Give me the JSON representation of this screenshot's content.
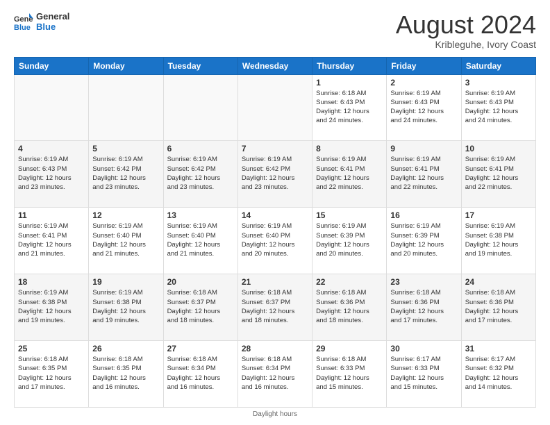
{
  "logo": {
    "line1": "General",
    "line2": "Blue"
  },
  "title": "August 2024",
  "subtitle": "Kribleguhe, Ivory Coast",
  "weekdays": [
    "Sunday",
    "Monday",
    "Tuesday",
    "Wednesday",
    "Thursday",
    "Friday",
    "Saturday"
  ],
  "footer": "Daylight hours",
  "weeks": [
    [
      {
        "day": "",
        "info": ""
      },
      {
        "day": "",
        "info": ""
      },
      {
        "day": "",
        "info": ""
      },
      {
        "day": "",
        "info": ""
      },
      {
        "day": "1",
        "info": "Sunrise: 6:18 AM\nSunset: 6:43 PM\nDaylight: 12 hours\nand 24 minutes."
      },
      {
        "day": "2",
        "info": "Sunrise: 6:19 AM\nSunset: 6:43 PM\nDaylight: 12 hours\nand 24 minutes."
      },
      {
        "day": "3",
        "info": "Sunrise: 6:19 AM\nSunset: 6:43 PM\nDaylight: 12 hours\nand 24 minutes."
      }
    ],
    [
      {
        "day": "4",
        "info": "Sunrise: 6:19 AM\nSunset: 6:43 PM\nDaylight: 12 hours\nand 23 minutes."
      },
      {
        "day": "5",
        "info": "Sunrise: 6:19 AM\nSunset: 6:42 PM\nDaylight: 12 hours\nand 23 minutes."
      },
      {
        "day": "6",
        "info": "Sunrise: 6:19 AM\nSunset: 6:42 PM\nDaylight: 12 hours\nand 23 minutes."
      },
      {
        "day": "7",
        "info": "Sunrise: 6:19 AM\nSunset: 6:42 PM\nDaylight: 12 hours\nand 23 minutes."
      },
      {
        "day": "8",
        "info": "Sunrise: 6:19 AM\nSunset: 6:41 PM\nDaylight: 12 hours\nand 22 minutes."
      },
      {
        "day": "9",
        "info": "Sunrise: 6:19 AM\nSunset: 6:41 PM\nDaylight: 12 hours\nand 22 minutes."
      },
      {
        "day": "10",
        "info": "Sunrise: 6:19 AM\nSunset: 6:41 PM\nDaylight: 12 hours\nand 22 minutes."
      }
    ],
    [
      {
        "day": "11",
        "info": "Sunrise: 6:19 AM\nSunset: 6:41 PM\nDaylight: 12 hours\nand 21 minutes."
      },
      {
        "day": "12",
        "info": "Sunrise: 6:19 AM\nSunset: 6:40 PM\nDaylight: 12 hours\nand 21 minutes."
      },
      {
        "day": "13",
        "info": "Sunrise: 6:19 AM\nSunset: 6:40 PM\nDaylight: 12 hours\nand 21 minutes."
      },
      {
        "day": "14",
        "info": "Sunrise: 6:19 AM\nSunset: 6:40 PM\nDaylight: 12 hours\nand 20 minutes."
      },
      {
        "day": "15",
        "info": "Sunrise: 6:19 AM\nSunset: 6:39 PM\nDaylight: 12 hours\nand 20 minutes."
      },
      {
        "day": "16",
        "info": "Sunrise: 6:19 AM\nSunset: 6:39 PM\nDaylight: 12 hours\nand 20 minutes."
      },
      {
        "day": "17",
        "info": "Sunrise: 6:19 AM\nSunset: 6:38 PM\nDaylight: 12 hours\nand 19 minutes."
      }
    ],
    [
      {
        "day": "18",
        "info": "Sunrise: 6:19 AM\nSunset: 6:38 PM\nDaylight: 12 hours\nand 19 minutes."
      },
      {
        "day": "19",
        "info": "Sunrise: 6:19 AM\nSunset: 6:38 PM\nDaylight: 12 hours\nand 19 minutes."
      },
      {
        "day": "20",
        "info": "Sunrise: 6:18 AM\nSunset: 6:37 PM\nDaylight: 12 hours\nand 18 minutes."
      },
      {
        "day": "21",
        "info": "Sunrise: 6:18 AM\nSunset: 6:37 PM\nDaylight: 12 hours\nand 18 minutes."
      },
      {
        "day": "22",
        "info": "Sunrise: 6:18 AM\nSunset: 6:36 PM\nDaylight: 12 hours\nand 18 minutes."
      },
      {
        "day": "23",
        "info": "Sunrise: 6:18 AM\nSunset: 6:36 PM\nDaylight: 12 hours\nand 17 minutes."
      },
      {
        "day": "24",
        "info": "Sunrise: 6:18 AM\nSunset: 6:36 PM\nDaylight: 12 hours\nand 17 minutes."
      }
    ],
    [
      {
        "day": "25",
        "info": "Sunrise: 6:18 AM\nSunset: 6:35 PM\nDaylight: 12 hours\nand 17 minutes."
      },
      {
        "day": "26",
        "info": "Sunrise: 6:18 AM\nSunset: 6:35 PM\nDaylight: 12 hours\nand 16 minutes."
      },
      {
        "day": "27",
        "info": "Sunrise: 6:18 AM\nSunset: 6:34 PM\nDaylight: 12 hours\nand 16 minutes."
      },
      {
        "day": "28",
        "info": "Sunrise: 6:18 AM\nSunset: 6:34 PM\nDaylight: 12 hours\nand 16 minutes."
      },
      {
        "day": "29",
        "info": "Sunrise: 6:18 AM\nSunset: 6:33 PM\nDaylight: 12 hours\nand 15 minutes."
      },
      {
        "day": "30",
        "info": "Sunrise: 6:17 AM\nSunset: 6:33 PM\nDaylight: 12 hours\nand 15 minutes."
      },
      {
        "day": "31",
        "info": "Sunrise: 6:17 AM\nSunset: 6:32 PM\nDaylight: 12 hours\nand 14 minutes."
      }
    ]
  ]
}
